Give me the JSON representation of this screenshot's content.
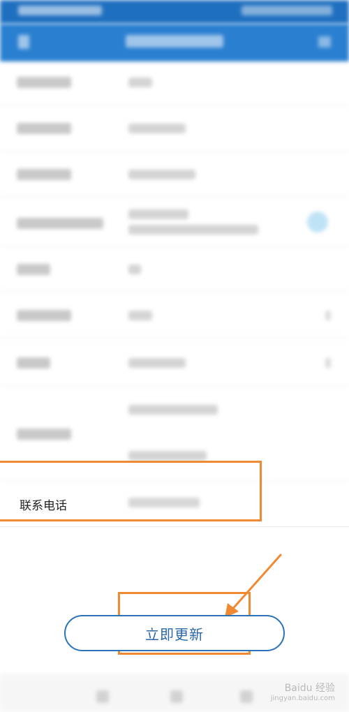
{
  "contact_row": {
    "label": "联系电话"
  },
  "update_button": {
    "label": "立即更新"
  },
  "watermark": {
    "brand": "Baidu 经验",
    "url": "jingyan.baidu.com"
  },
  "colors": {
    "header": "#2a7fd0",
    "highlight": "#f08a32",
    "button_border": "#2a73b8"
  }
}
